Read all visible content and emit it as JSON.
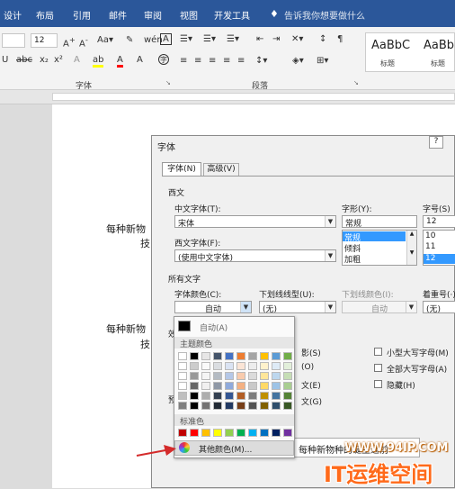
{
  "ribbon_tabs": [
    "设计",
    "布局",
    "引用",
    "邮件",
    "审阅",
    "视图",
    "开发工具"
  ],
  "tell_me": "告诉我你想要做什么",
  "font_size": "12",
  "groups": {
    "font": "字体",
    "paragraph": "段落"
  },
  "styles": [
    {
      "preview": "AaBbC",
      "name": "标题"
    },
    {
      "preview": "AaBb",
      "name": "标题"
    }
  ],
  "doc_text": [
    "每种新物",
    "技",
    "每种新物",
    "技"
  ],
  "dialog": {
    "title": "字体",
    "help": "?",
    "tabs": [
      "字体(N)",
      "高级(V)"
    ],
    "section_xiwen": "西文",
    "cn_font_label": "中文字体(T):",
    "cn_font_value": "宋体",
    "style_label": "字形(Y):",
    "style_value": "常规",
    "style_options": [
      "常规",
      "倾斜",
      "加粗"
    ],
    "size_label": "字号(S)",
    "size_value": "12",
    "size_options": [
      "10",
      "11",
      "12"
    ],
    "west_font_label": "西文字体(F):",
    "west_font_value": "(使用中文字体)",
    "section_all": "所有文字",
    "color_label": "字体颜色(C):",
    "color_value": "自动",
    "underline_label": "下划线线型(U):",
    "underline_value": "(无)",
    "underline_color_label": "下划线颜色(I):",
    "underline_color_value": "自动",
    "emphasis_label": "着重号(·)",
    "emphasis_value": "(无)",
    "effects_partial": "效",
    "effects_left": [
      "影(S)",
      "(O)",
      "文(E)",
      "文(G)"
    ],
    "effects_right": [
      "小型大写字母(M)",
      "全部大写字母(A)",
      "隐藏(H)"
    ],
    "preview_partial": "预",
    "preview_text": "每种新物种的诞生通前"
  },
  "popup": {
    "auto": "自动(A)",
    "theme_colors": "主题颜色",
    "standard_colors": "标准色",
    "more_colors": "其他颜色(M)..."
  },
  "theme_top": [
    "#ffffff",
    "#000000",
    "#e7e6e6",
    "#44546a",
    "#4472c4",
    "#ed7d31",
    "#a5a5a5",
    "#ffc000",
    "#5b9bd5",
    "#70ad47"
  ],
  "standard": [
    "#c00000",
    "#ff0000",
    "#ffc000",
    "#ffff00",
    "#92d050",
    "#00b050",
    "#00b0f0",
    "#0070c0",
    "#002060",
    "#7030a0"
  ],
  "watermark": {
    "url": "WWW.94IP.COM",
    "brand": "IT运维空间"
  }
}
